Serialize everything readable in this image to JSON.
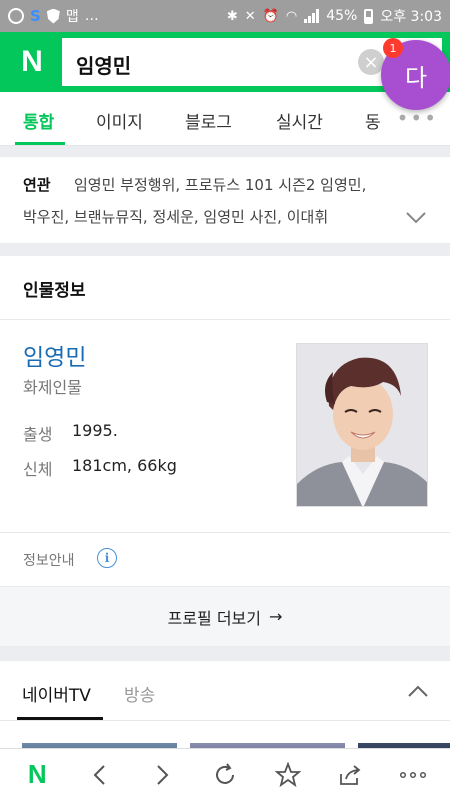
{
  "status_bar": {
    "left_text": "…",
    "notif_label": "맵",
    "battery": "45%",
    "time": "오후 3:03"
  },
  "search": {
    "logo": "N",
    "query": "임영민",
    "clear_label": "×"
  },
  "fab": {
    "label": "다",
    "badge": "1"
  },
  "tabs": [
    {
      "label": "통합",
      "active": true
    },
    {
      "label": "이미지"
    },
    {
      "label": "블로그"
    },
    {
      "label": "실시간"
    },
    {
      "label": "동"
    }
  ],
  "tabs_more": "•••",
  "related": {
    "label": "연관",
    "line1": "임영민 부정행위, 프로듀스 101 시즌2 임영민,",
    "line2": "박우진, 브랜뉴뮤직, 정세운, 임영민 사진, 이대휘"
  },
  "profile": {
    "section_title": "인물정보",
    "name": "임영민",
    "description": "화제인물",
    "rows": [
      {
        "label": "출생",
        "value": "1995."
      },
      {
        "label": "신체",
        "value": "181cm, 66kg"
      }
    ],
    "info_guide": "정보안내",
    "info_icon": "i",
    "more_button": "프로필 더보기",
    "more_arrow": "→"
  },
  "naver_tv": {
    "tab_active": "네이버TV",
    "tab_other": "방송"
  },
  "toolbar": {
    "logo": "N",
    "icons": [
      "back-icon",
      "forward-icon",
      "refresh-icon",
      "bookmark-star-icon",
      "share-icon",
      "more-icon"
    ]
  },
  "colors": {
    "brand_green": "#03c75a",
    "fab_purple": "#a84fd1",
    "link_blue": "#1a6bb5",
    "badge_red": "#ff3b2f"
  }
}
